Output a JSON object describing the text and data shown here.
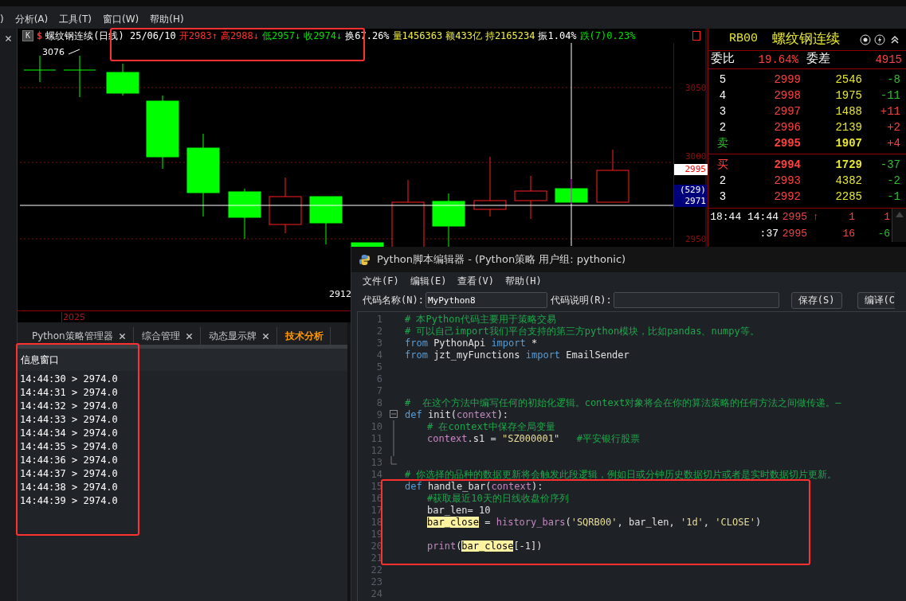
{
  "menu": [
    ")",
    "分析(A)",
    "工具(T)",
    "窗口(W)",
    "帮助(H)"
  ],
  "chart": {
    "badge": "K",
    "mark": "$",
    "quote": [
      {
        "text": "螺纹钢连续(日线) 25/06/10",
        "color": "#ffffff"
      },
      {
        "text": "开2983↑",
        "color": "#ff3030"
      },
      {
        "text": "高2988↓",
        "color": "#ff3030"
      },
      {
        "text": "低2957↓",
        "color": "#00e000"
      },
      {
        "text": "收2974↓",
        "color": "#00e000"
      },
      {
        "text": "换67.26%",
        "color": "#ffffff"
      },
      {
        "text": "量1456363",
        "color": "#f0f040"
      },
      {
        "text": "额433亿",
        "color": "#f0f040"
      },
      {
        "text": "持2165234",
        "color": "#f0f040"
      },
      {
        "text": "振1.04%",
        "color": "#ffffff"
      },
      {
        "text": "跌(7)0.23%",
        "color": "#00e000"
      }
    ],
    "high_label": "3076",
    "low_label": "2912",
    "year": "2025",
    "axis": [
      "3050",
      "3000",
      "2950"
    ],
    "last_price": "2995",
    "cursor_count": "(529)",
    "cursor_price": "2971"
  },
  "order_book": {
    "code": "RB00",
    "name": "螺纹钢连续",
    "ratio_label": "委比",
    "ratio": "19.64%",
    "diff_label": "委差",
    "diff": "4915",
    "asks": [
      {
        "kind": "level",
        "label": "5",
        "price": "2999",
        "volume": "2546",
        "change": "-8",
        "color": "#2ec02e"
      },
      {
        "kind": "level",
        "label": "4",
        "price": "2998",
        "volume": "1975",
        "change": "-11",
        "color": "#2ec02e"
      },
      {
        "kind": "level",
        "label": "3",
        "price": "2997",
        "volume": "1488",
        "change": "+11",
        "color": "#ff4040"
      },
      {
        "kind": "level",
        "label": "2",
        "price": "2996",
        "volume": "2139",
        "change": "+2",
        "color": "#ff4040"
      },
      {
        "kind": "sell",
        "label": "卖",
        "price": "2995",
        "volume": "1907",
        "change": "+4",
        "color": "#ff4040"
      }
    ],
    "bids": [
      {
        "kind": "buy",
        "label": "买",
        "price": "2994",
        "volume": "1729",
        "change": "-37",
        "color": "#2ec02e"
      },
      {
        "kind": "level",
        "label": "2",
        "price": "2993",
        "volume": "4382",
        "change": "-2",
        "color": "#2ec02e"
      },
      {
        "kind": "level",
        "label": "3",
        "price": "2992",
        "volume": "2285",
        "change": "-1",
        "color": "#2ec02e"
      }
    ],
    "ticks": [
      {
        "time": "18:44 14:44",
        "price": "2995",
        "arrow": "↑",
        "volume": "1",
        "count": "1",
        "color": "#ff4040"
      },
      {
        "time": ":37",
        "price": "2995",
        "volume": "16",
        "count": "-6",
        "color": "#2ec02e"
      }
    ]
  },
  "tabs": [
    {
      "label": "Python策略管理器",
      "closable": true,
      "selected": false
    },
    {
      "label": "综合管理",
      "closable": true,
      "selected": false
    },
    {
      "label": "动态显示牌",
      "closable": true,
      "selected": false
    },
    {
      "label": "技术分析",
      "closable": false,
      "selected": true
    }
  ],
  "info_window": {
    "title": "信息窗口",
    "lines": [
      "14:44:30 > 2974.0",
      "14:44:31 > 2974.0",
      "14:44:32 > 2974.0",
      "14:44:33 > 2974.0",
      "14:44:34 > 2974.0",
      "14:44:35 > 2974.0",
      "14:44:36 > 2974.0",
      "14:44:37 > 2974.0",
      "14:44:38 > 2974.0",
      "14:44:39 > 2974.0"
    ]
  },
  "editor": {
    "title": "Python脚本编辑器 - (Python策略 用户组: pythonic)",
    "menu": [
      "文件(F)",
      "编辑(E)",
      "查看(V)",
      "帮助(H)"
    ],
    "name_label": "代码名称(N):",
    "name_value": "MyPython8",
    "desc_label": "代码说明(R):",
    "buttons": [
      "保存(S)",
      "编译(C"
    ],
    "lines": [
      {
        "number": "1",
        "kind": "code",
        "indented": false,
        "tokens": [
          {
            "kind": "comment",
            "text": "# 本Python代码主要用于策略交易"
          }
        ]
      },
      {
        "number": "2",
        "kind": "code",
        "indented": false,
        "tokens": [
          {
            "kind": "comment",
            "text": "# 可以自己import我们平台支持的第三方python模块，比如pandas、numpy等。"
          }
        ]
      },
      {
        "number": "3",
        "kind": "code",
        "indented": false,
        "tokens": [
          {
            "kind": "keyword",
            "text": "from"
          },
          {
            "kind": "plain",
            "text": " PythonApi "
          },
          {
            "kind": "keyword",
            "text": "import"
          },
          {
            "kind": "plain",
            "text": " *"
          }
        ]
      },
      {
        "number": "4",
        "kind": "code",
        "indented": false,
        "tokens": [
          {
            "kind": "keyword",
            "text": "from"
          },
          {
            "kind": "plain",
            "text": " jzt_myFunctions "
          },
          {
            "kind": "keyword",
            "text": "import"
          },
          {
            "kind": "plain",
            "text": " EmailSender"
          }
        ]
      },
      {
        "number": "5",
        "kind": "code"
      },
      {
        "number": "6",
        "kind": "code"
      },
      {
        "number": "7",
        "kind": "code"
      },
      {
        "number": "8",
        "kind": "code",
        "indented": false,
        "tokens": [
          {
            "kind": "comment",
            "text": "#  在这个方法中编写任何的初始化逻辑。context对象将会在你的算法策略的任何方法之间做传递。—"
          }
        ]
      },
      {
        "number": "9",
        "kind": "fold_start",
        "indented": false,
        "tokens": [
          {
            "kind": "keyword",
            "text": "def"
          },
          {
            "kind": "plain",
            "text": " init("
          },
          {
            "kind": "name",
            "text": "context"
          },
          {
            "kind": "plain",
            "text": "):"
          }
        ]
      },
      {
        "number": "10",
        "kind": "fold_body",
        "indented": true,
        "tokens": [
          {
            "kind": "comment",
            "text": "# 在context中保存全局变量"
          }
        ]
      },
      {
        "number": "11",
        "kind": "fold_body",
        "indented": true,
        "tokens": [
          {
            "kind": "name",
            "text": "context"
          },
          {
            "kind": "plain",
            "text": ".s1 = "
          },
          {
            "kind": "string",
            "text": "\"SZ000001\""
          },
          {
            "kind": "comment",
            "text": "#平安银行股票"
          }
        ]
      },
      {
        "number": "12",
        "kind": "fold_body"
      },
      {
        "number": "13",
        "kind": "fold_end"
      },
      {
        "number": "14",
        "kind": "code",
        "indented": false,
        "tokens": [
          {
            "kind": "comment",
            "text": "# 你选择的品种的数据更新将会触发此段逻辑，例如日或分钟历史数据切片或者是实时数据切片更新。"
          }
        ]
      },
      {
        "number": "15",
        "kind": "code",
        "indented": false,
        "tokens": [
          {
            "kind": "keyword",
            "text": "def"
          },
          {
            "kind": "plain",
            "text": " handle_bar("
          },
          {
            "kind": "name",
            "text": "context"
          },
          {
            "kind": "plain",
            "text": "):"
          }
        ]
      },
      {
        "number": "16",
        "kind": "code",
        "indented": true,
        "tokens": [
          {
            "kind": "comment",
            "text": "#获取最近10天的日线收盘价序列"
          }
        ]
      },
      {
        "number": "17",
        "kind": "code",
        "indented": true,
        "tokens": [
          {
            "kind": "plain",
            "text": "bar_len= 10"
          }
        ]
      },
      {
        "number": "18",
        "kind": "code",
        "indented": true,
        "tokens": [
          {
            "kind": "mark",
            "text": "bar_close"
          },
          {
            "kind": "plain",
            "text": " = "
          },
          {
            "kind": "name",
            "text": "history_bars"
          },
          {
            "kind": "plain",
            "text": "("
          },
          {
            "kind": "string",
            "text": "'SQRB00'"
          },
          {
            "kind": "plain",
            "text": ", bar_len, "
          },
          {
            "kind": "string",
            "text": "'1d'"
          },
          {
            "kind": "plain",
            "text": ", "
          },
          {
            "kind": "string",
            "text": "'CLOSE'"
          },
          {
            "kind": "plain",
            "text": ")"
          }
        ]
      },
      {
        "number": "19",
        "kind": "code"
      },
      {
        "number": "20",
        "kind": "code",
        "indented": true,
        "tokens": [
          {
            "kind": "name",
            "text": "print"
          },
          {
            "kind": "plain",
            "text": "("
          },
          {
            "kind": "mark",
            "text": "bar_close"
          },
          {
            "kind": "plain",
            "text": "[-1])"
          }
        ]
      },
      {
        "number": "21",
        "kind": "code"
      },
      {
        "number": "22",
        "kind": "code"
      },
      {
        "number": "23",
        "kind": "code"
      },
      {
        "number": "24",
        "kind": "code"
      }
    ]
  }
}
